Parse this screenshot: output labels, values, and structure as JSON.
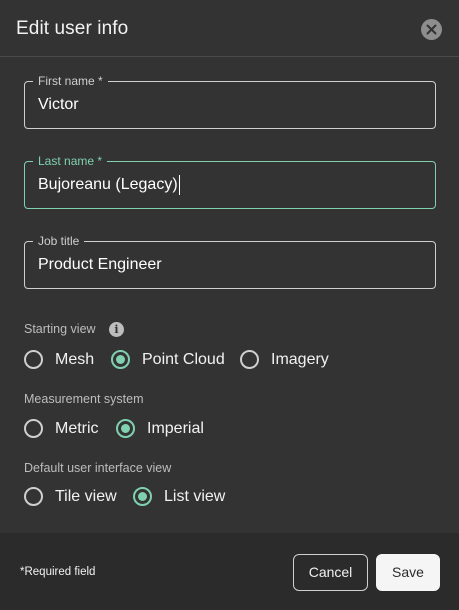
{
  "dialog": {
    "title": "Edit user info",
    "close_icon": "close-icon"
  },
  "fields": {
    "first_name": {
      "label": "First name *",
      "value": "Victor"
    },
    "last_name": {
      "label": "Last name *",
      "value": "Bujoreanu (Legacy)"
    },
    "job_title": {
      "label": "Job title",
      "value": "Product Engineer"
    }
  },
  "starting_view": {
    "label": "Starting view",
    "info_icon": "info-icon",
    "options": [
      "Mesh",
      "Point Cloud",
      "Imagery"
    ],
    "selected": "Point Cloud"
  },
  "measurement_system": {
    "label": "Measurement system",
    "options": [
      "Metric",
      "Imperial"
    ],
    "selected": "Imperial"
  },
  "ui_view": {
    "label": "Default user interface view",
    "options": [
      "Tile view",
      "List view"
    ],
    "selected": "List view"
  },
  "footer": {
    "required_note": "*Required field",
    "cancel_label": "Cancel",
    "save_label": "Save"
  },
  "colors": {
    "accent": "#7fd1b0",
    "background": "#333333",
    "footer_background": "#2b2b2b"
  }
}
